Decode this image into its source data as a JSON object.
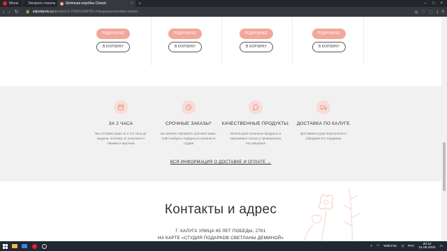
{
  "browser": {
    "tabs": [
      {
        "label": "Меню"
      },
      {
        "label": "Экспресс-панель"
      },
      {
        "label": "Шляпная коробка Classic"
      }
    ],
    "url_host": "sdpodarok.ru",
    "url_path": "/tproduct/1-749616336761-shlyapnaya-korobka-classic"
  },
  "products": {
    "gift_label": "ПОДРОБНЕЕ",
    "cart_label": "В КОРЗИНУ"
  },
  "features": [
    {
      "title": "ЗА 2 ЧАСА",
      "text": "Мы готовим заказ за 1-1,5 часа до выдачи, поэтому он получается свежим и вкусным",
      "icon": "calendar-icon"
    },
    {
      "title": "СРОЧНЫЕ ЗАКАЗЫ*",
      "text": "Вы можете оформить срочный заказ, либо выбрать подарок из наличия в студии",
      "icon": "clock-icon"
    },
    {
      "title": "КАЧЕСТВЕННЫЕ ПРОДУКТЫ:",
      "text": "Используем сезонные продукты и закупаемся только у проверенных поставщиков",
      "icon": "chat-icon"
    },
    {
      "title": "ДОСТАВКА ПО КАЛУГЕ",
      "text": "Доставим в руки получателю и обрадуем его подарком",
      "icon": "truck-icon"
    }
  ],
  "delivery_link": "ВСЯ ИНФОРМАЦИЯ О ДОСТАВКЕ И ОПЛАТЕ →",
  "contacts": {
    "title": "Контакты и адрес",
    "address": "Г. КАЛУГА УЛИЦА 65 ЛЕТ ПОБЕДЫ, 27К1",
    "map_text": "НА КАРТЕ «СТУДИЯ ПОДАРКОВ СВЕТЛАНЫ ДЕМИНОЙ»"
  },
  "taskbar": {
    "wifi": "Wild Fire",
    "lang": "РУС",
    "time": "20:12",
    "date": "21.08.2022"
  },
  "colors": {
    "accent": "#f1a79a",
    "icon_bg": "#f9dcd6",
    "band": "#f1f1f1"
  }
}
